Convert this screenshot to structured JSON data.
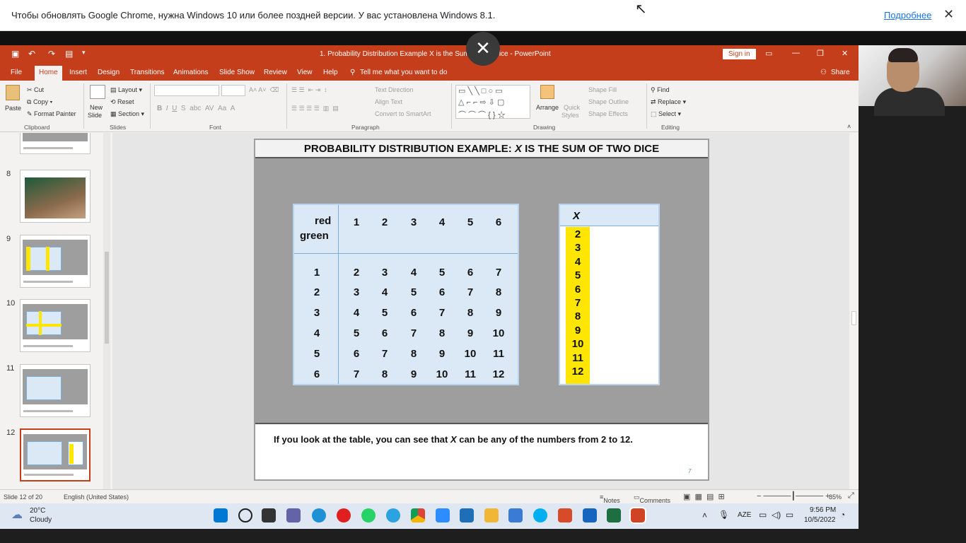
{
  "infobar": {
    "message": "Чтобы обновлять Google Chrome, нужна Windows 10 или более поздней версии. У вас установлена Windows 8.1.",
    "more_link": "Подробнее",
    "close": "✕"
  },
  "window": {
    "title": "1. Probability Distribution Example X is the Sum of Two Dice - PowerPoint",
    "sign_in": "Sign in",
    "close_overlay": "✕"
  },
  "tabs": [
    "File",
    "Home",
    "Insert",
    "Design",
    "Transitions",
    "Animations",
    "Slide Show",
    "Review",
    "View",
    "Help"
  ],
  "tell_me": "Tell me what you want to do",
  "share": "Share",
  "ribbon": {
    "clipboard": {
      "paste": "Paste",
      "cut": "Cut",
      "copy": "Copy",
      "format_painter": "Format Painter",
      "label": "Clipboard"
    },
    "slides": {
      "new_slide_1": "New",
      "new_slide_2": "Slide",
      "layout": "Layout",
      "reset": "Reset",
      "section": "Section",
      "label": "Slides"
    },
    "font": {
      "label": "Font"
    },
    "paragraph": {
      "text_direction": "Text Direction",
      "align_text": "Align Text",
      "convert_smartart": "Convert to SmartArt",
      "label": "Paragraph"
    },
    "drawing": {
      "arrange": "Arrange",
      "quick_styles_1": "Quick",
      "quick_styles_2": "Styles",
      "shape_fill": "Shape Fill",
      "shape_outline": "Shape Outline",
      "shape_effects": "Shape Effects",
      "label": "Drawing"
    },
    "editing": {
      "find": "Find",
      "replace": "Replace",
      "select": "Select",
      "label": "Editing"
    }
  },
  "thumbnails": {
    "numbers": [
      "8",
      "9",
      "10",
      "11",
      "12"
    ],
    "selected": "12"
  },
  "slide": {
    "title_prefix": "PROBABILITY DISTRIBUTION EXAMPLE: ",
    "title_var": "X",
    "title_suffix": " IS THE SUM OF TWO DICE",
    "header_red": "red",
    "header_green": "green",
    "col_headers": [
      "1",
      "2",
      "3",
      "4",
      "5",
      "6"
    ],
    "row_headers": [
      "1",
      "2",
      "3",
      "4",
      "5",
      "6"
    ],
    "sums": [
      [
        "2",
        "3",
        "4",
        "5",
        "6",
        "7"
      ],
      [
        "3",
        "4",
        "5",
        "6",
        "7",
        "8"
      ],
      [
        "4",
        "5",
        "6",
        "7",
        "8",
        "9"
      ],
      [
        "5",
        "6",
        "7",
        "8",
        "9",
        "10"
      ],
      [
        "6",
        "7",
        "8",
        "9",
        "10",
        "11"
      ],
      [
        "7",
        "8",
        "9",
        "10",
        "11",
        "12"
      ]
    ],
    "x_label": "X",
    "x_values": [
      "2",
      "3",
      "4",
      "5",
      "6",
      "7",
      "8",
      "9",
      "10",
      "11",
      "12"
    ],
    "note_pre": "If you look at the table, you can see that ",
    "note_var": "X",
    "note_post": " can be any of the numbers from 2 to 12.",
    "page_num": "7"
  },
  "status": {
    "slide": "Slide 12 of 20",
    "language": "English (United States)",
    "notes": "Notes",
    "comments": "Comments",
    "zoom": "85%"
  },
  "taskbar": {
    "temp": "20°C",
    "weather": "Cloudy",
    "lang": "AZE",
    "time": "9:56 PM",
    "date": "10/5/2022"
  },
  "colors": {
    "accent": "#c43e1c",
    "table_fill": "#dbe9f7",
    "highlight": "#ffe600"
  }
}
